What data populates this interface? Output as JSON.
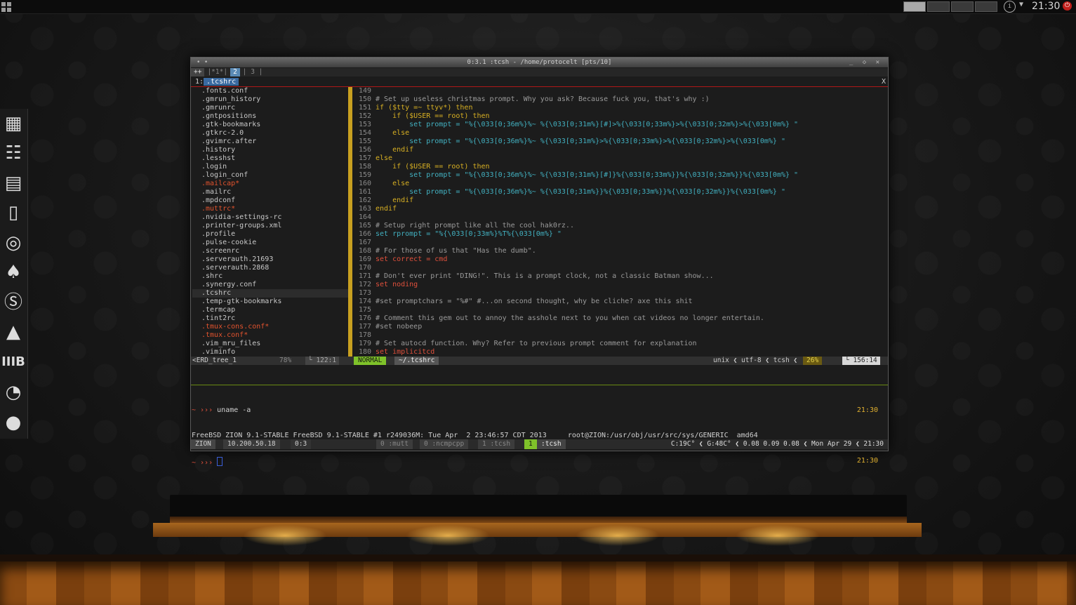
{
  "topbar": {
    "clock": "21:30"
  },
  "window": {
    "title": "0:3.1 :tcsh - /home/protocelt [pts/10]"
  },
  "tabline": {
    "tabs": [
      {
        "label": "++"
      },
      {
        "label": "|*1*|"
      },
      {
        "label": "2"
      },
      {
        "label": "| 3 |"
      }
    ]
  },
  "bufline": {
    "number": "1:",
    "name": ".tcshrc",
    "close": "X"
  },
  "tree": {
    "items": [
      {
        "name": ".fonts.conf",
        "mod": false
      },
      {
        "name": ".gmrun_history",
        "mod": false
      },
      {
        "name": ".gmrunrc",
        "mod": false
      },
      {
        "name": ".gntpositions",
        "mod": false
      },
      {
        "name": ".gtk-bookmarks",
        "mod": false
      },
      {
        "name": ".gtkrc-2.0",
        "mod": false
      },
      {
        "name": ".gvimrc.after",
        "mod": false
      },
      {
        "name": ".history",
        "mod": false
      },
      {
        "name": ".lesshst",
        "mod": false
      },
      {
        "name": ".login",
        "mod": false
      },
      {
        "name": ".login_conf",
        "mod": false
      },
      {
        "name": ".mailcap*",
        "mod": true
      },
      {
        "name": ".mailrc",
        "mod": false
      },
      {
        "name": ".mpdconf",
        "mod": false
      },
      {
        "name": ".muttrc*",
        "mod": true
      },
      {
        "name": ".nvidia-settings-rc",
        "mod": false
      },
      {
        "name": ".printer-groups.xml",
        "mod": false
      },
      {
        "name": ".profile",
        "mod": false
      },
      {
        "name": ".pulse-cookie",
        "mod": false
      },
      {
        "name": ".screenrc",
        "mod": false
      },
      {
        "name": ".serverauth.21693",
        "mod": false
      },
      {
        "name": ".serverauth.2868",
        "mod": false
      },
      {
        "name": ".shrc",
        "mod": false
      },
      {
        "name": ".synergy.conf",
        "mod": false
      },
      {
        "name": ".tcshrc",
        "mod": false,
        "current": true
      },
      {
        "name": ".temp-gtk-bookmarks",
        "mod": false
      },
      {
        "name": ".termcap",
        "mod": false
      },
      {
        "name": ".tint2rc",
        "mod": false
      },
      {
        "name": ".tmux-cons.conf*",
        "mod": true
      },
      {
        "name": ".tmux.conf*",
        "mod": true
      },
      {
        "name": ".vim_mru_files",
        "mod": false
      },
      {
        "name": ".viminfo",
        "mod": false
      }
    ]
  },
  "code": {
    "lines": [
      {
        "n": "149",
        "t": "",
        "c": "cm"
      },
      {
        "n": "150",
        "t": "# Set up useless christmas prompt. Why you ask? Because fuck you, that's why :)",
        "c": "cm"
      },
      {
        "n": "151",
        "t": "if ($tty =~ ttyv*) then",
        "c": "kw"
      },
      {
        "n": "152",
        "t": "    if ($USER == root) then",
        "c": "kw"
      },
      {
        "n": "153",
        "t": "        set prompt = \"%{\\033[0;36m%}%~ %{\\033[0;31m%}[#]>%{\\033[0;33m%}>%{\\033[0;32m%}>%{\\033[0m%} \"",
        "c": "st"
      },
      {
        "n": "154",
        "t": "    else",
        "c": "kw"
      },
      {
        "n": "155",
        "t": "        set prompt = \"%{\\033[0;36m%}%~ %{\\033[0;31m%}>%{\\033[0;33m%}>%{\\033[0;32m%}>%{\\033[0m%} \"",
        "c": "st"
      },
      {
        "n": "156",
        "t": "    endif",
        "c": "kw"
      },
      {
        "n": "157",
        "t": "else",
        "c": "kw"
      },
      {
        "n": "158",
        "t": "    if ($USER == root) then",
        "c": "kw"
      },
      {
        "n": "159",
        "t": "        set prompt = \"%{\\033[0;36m%}%~ %{\\033[0;31m%}[#]}%{\\033[0;33m%}}%{\\033[0;32m%}}%{\\033[0m%} \"",
        "c": "st"
      },
      {
        "n": "160",
        "t": "    else",
        "c": "kw"
      },
      {
        "n": "161",
        "t": "        set prompt = \"%{\\033[0;36m%}%~ %{\\033[0;31m%}}%{\\033[0;33m%}}%{\\033[0;32m%}}%{\\033[0m%} \"",
        "c": "st"
      },
      {
        "n": "162",
        "t": "    endif",
        "c": "kw"
      },
      {
        "n": "163",
        "t": "endif",
        "c": "kw"
      },
      {
        "n": "164",
        "t": "",
        "c": "cm"
      },
      {
        "n": "165",
        "t": "# Setup right prompt like all the cool hak0rz..",
        "c": "cm"
      },
      {
        "n": "166",
        "t": "set rprompt = \"%{\\033[0;33m%}%T%{\\033[0m%} \"",
        "c": "st"
      },
      {
        "n": "167",
        "t": "",
        "c": "cm"
      },
      {
        "n": "168",
        "t": "# For those of us that \"Has the dumb\".",
        "c": "cm"
      },
      {
        "n": "169",
        "t": "set correct = cmd",
        "c": "vr"
      },
      {
        "n": "170",
        "t": "",
        "c": "cm"
      },
      {
        "n": "171",
        "t": "# Don't ever print \"DING!\". This is a prompt clock, not a classic Batman show...",
        "c": "cm"
      },
      {
        "n": "172",
        "t": "set noding",
        "c": "vr"
      },
      {
        "n": "173",
        "t": "",
        "c": "cm"
      },
      {
        "n": "174",
        "t": "#set promptchars = \"%#\" #...on second thought, why be cliche? axe this shit",
        "c": "cm"
      },
      {
        "n": "175",
        "t": "",
        "c": "cm"
      },
      {
        "n": "176",
        "t": "# Comment this gem out to annoy the asshole next to you when cat videos no longer entertain.",
        "c": "cm"
      },
      {
        "n": "177",
        "t": "#set nobeep",
        "c": "cm"
      },
      {
        "n": "178",
        "t": "",
        "c": "cm"
      },
      {
        "n": "179",
        "t": "# Set autocd function. Why? Refer to previous prompt comment for explanation",
        "c": "cm"
      },
      {
        "n": "180",
        "t": "set implicitcd",
        "c": "vr"
      }
    ]
  },
  "status": {
    "tree": "<ERD_tree_1",
    "tree_pct": "78%",
    "tree_pos": "└ 122:1",
    "mode": "NORMAL",
    "file": "~/.tcshrc",
    "fileinfo": "unix ❮ utf-8 ❮ tcsh ❮",
    "pct": "26%",
    "pos": "└ 156:14"
  },
  "shell": {
    "line1_prompt": "~ ›››",
    "line1_cmd": " uname -a",
    "line1_time": "21:30",
    "line2": "FreeBSD ZION 9.1-STABLE FreeBSD 9.1-STABLE #1 r249036M: Tue Apr  2 23:46:57 CDT 2013     root@ZION:/usr/obj/usr/src/sys/GENERIC  amd64",
    "line3_prompt": "~ ››› ",
    "line3_time": "21:30"
  },
  "tmux": {
    "host": "ZION",
    "ip": "10.200.50.18",
    "pane": "0:3",
    "windows": [
      {
        "label": "0 :mutt"
      },
      {
        "label": "0 :ncmpcpp"
      },
      {
        "label": "1 :tcsh"
      }
    ],
    "active_num": "1",
    "active_name": ":tcsh",
    "right": "C:19C° ❮ G:48C° ❮ 0.08 0.09 0.08 ❮ Mon Apr 29 ❮ 21:30"
  },
  "dock": {
    "icons": [
      "grid-icon",
      "mixer-icon",
      "files-icon",
      "document-icon",
      "chrome-icon",
      "bird-icon",
      "skype-icon",
      "vlc-icon",
      "library-icon",
      "speedometer-icon",
      "chat-icon"
    ]
  }
}
